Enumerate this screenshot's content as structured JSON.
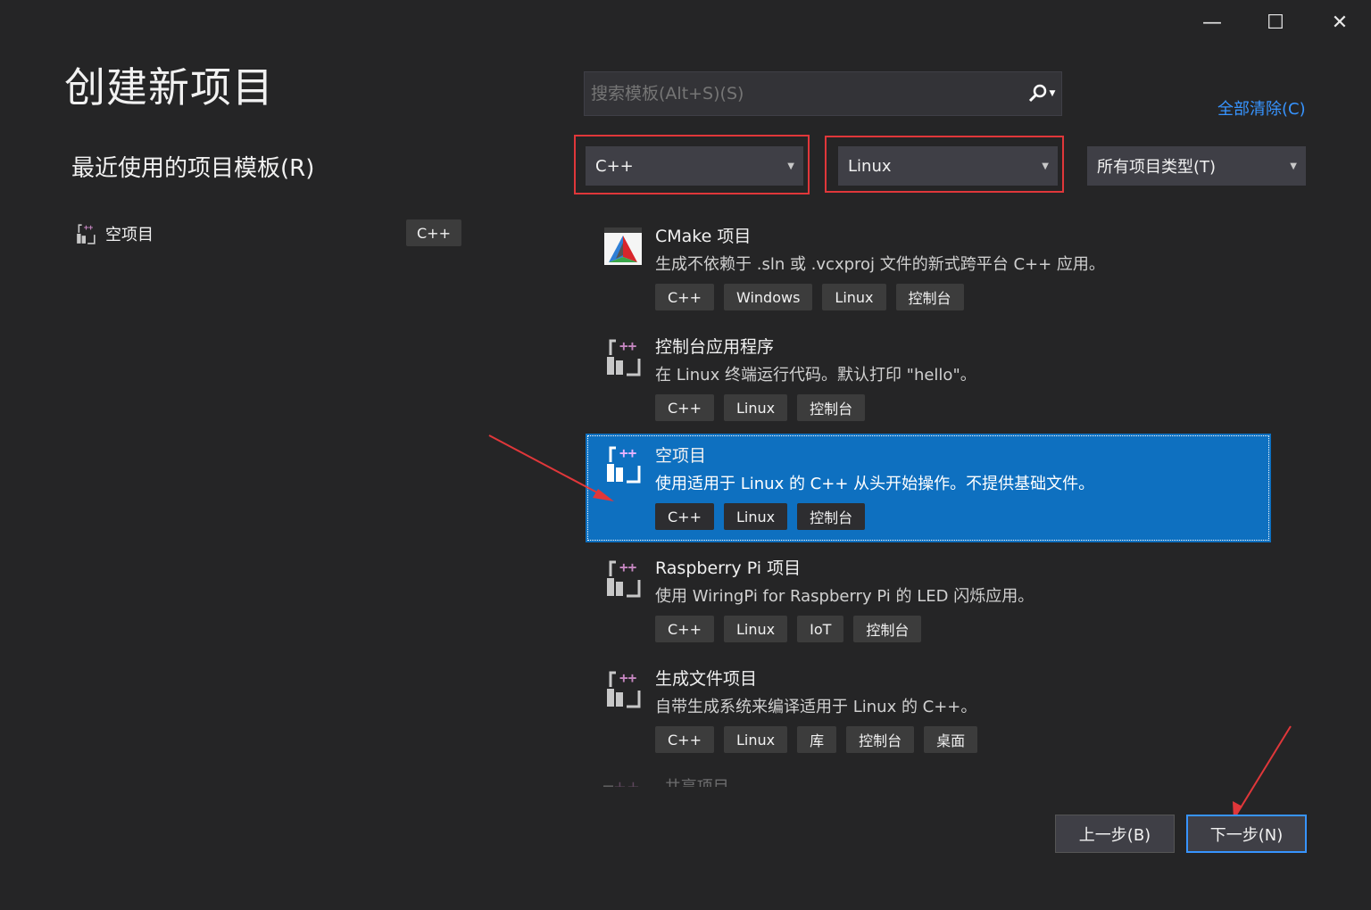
{
  "window": {
    "minimize_glyph": "—",
    "maximize_glyph": "☐",
    "close_glyph": "✕"
  },
  "page": {
    "title": "创建新项目",
    "recent_heading": "最近使用的项目模板(R)"
  },
  "recent": {
    "items": [
      {
        "label": "空项目",
        "tag": "C++"
      }
    ]
  },
  "search": {
    "placeholder": "搜索模板(Alt+S)(S)",
    "value": ""
  },
  "filters": {
    "clear_all": "全部清除(C)",
    "language": "C++",
    "platform": "Linux",
    "project_type": "所有项目类型(T)"
  },
  "templates": [
    {
      "name": "CMake 项目",
      "desc": "生成不依赖于 .sln 或 .vcxproj 文件的新式跨平台 C++ 应用。",
      "tags": [
        "C++",
        "Windows",
        "Linux",
        "控制台"
      ],
      "icon": "cmake-icon"
    },
    {
      "name": "控制台应用程序",
      "desc": "在 Linux 终端运行代码。默认打印 \"hello\"。",
      "tags": [
        "C++",
        "Linux",
        "控制台"
      ],
      "icon": "linux-cpp-icon"
    },
    {
      "name": "空项目",
      "desc": "使用适用于 Linux 的 C++ 从头开始操作。不提供基础文件。",
      "tags": [
        "C++",
        "Linux",
        "控制台"
      ],
      "icon": "linux-cpp-icon",
      "selected": true
    },
    {
      "name": "Raspberry Pi 项目",
      "desc": "使用 WiringPi for Raspberry Pi 的 LED 闪烁应用。",
      "tags": [
        "C++",
        "Linux",
        "IoT",
        "控制台"
      ],
      "icon": "linux-cpp-icon"
    },
    {
      "name": "生成文件项目",
      "desc": "自带生成系统来编译适用于 Linux 的 C++。",
      "tags": [
        "C++",
        "Linux",
        "库",
        "控制台",
        "桌面"
      ],
      "icon": "linux-cpp-icon"
    }
  ],
  "partial_item": {
    "name": "共享项目"
  },
  "footer": {
    "back": "上一步(B)",
    "next": "下一步(N)"
  },
  "colors": {
    "background": "#252526",
    "selection": "#0e70c0",
    "highlight_box": "#e0373a",
    "annotation_arrow": "#e0373a",
    "link": "#3794ff"
  }
}
